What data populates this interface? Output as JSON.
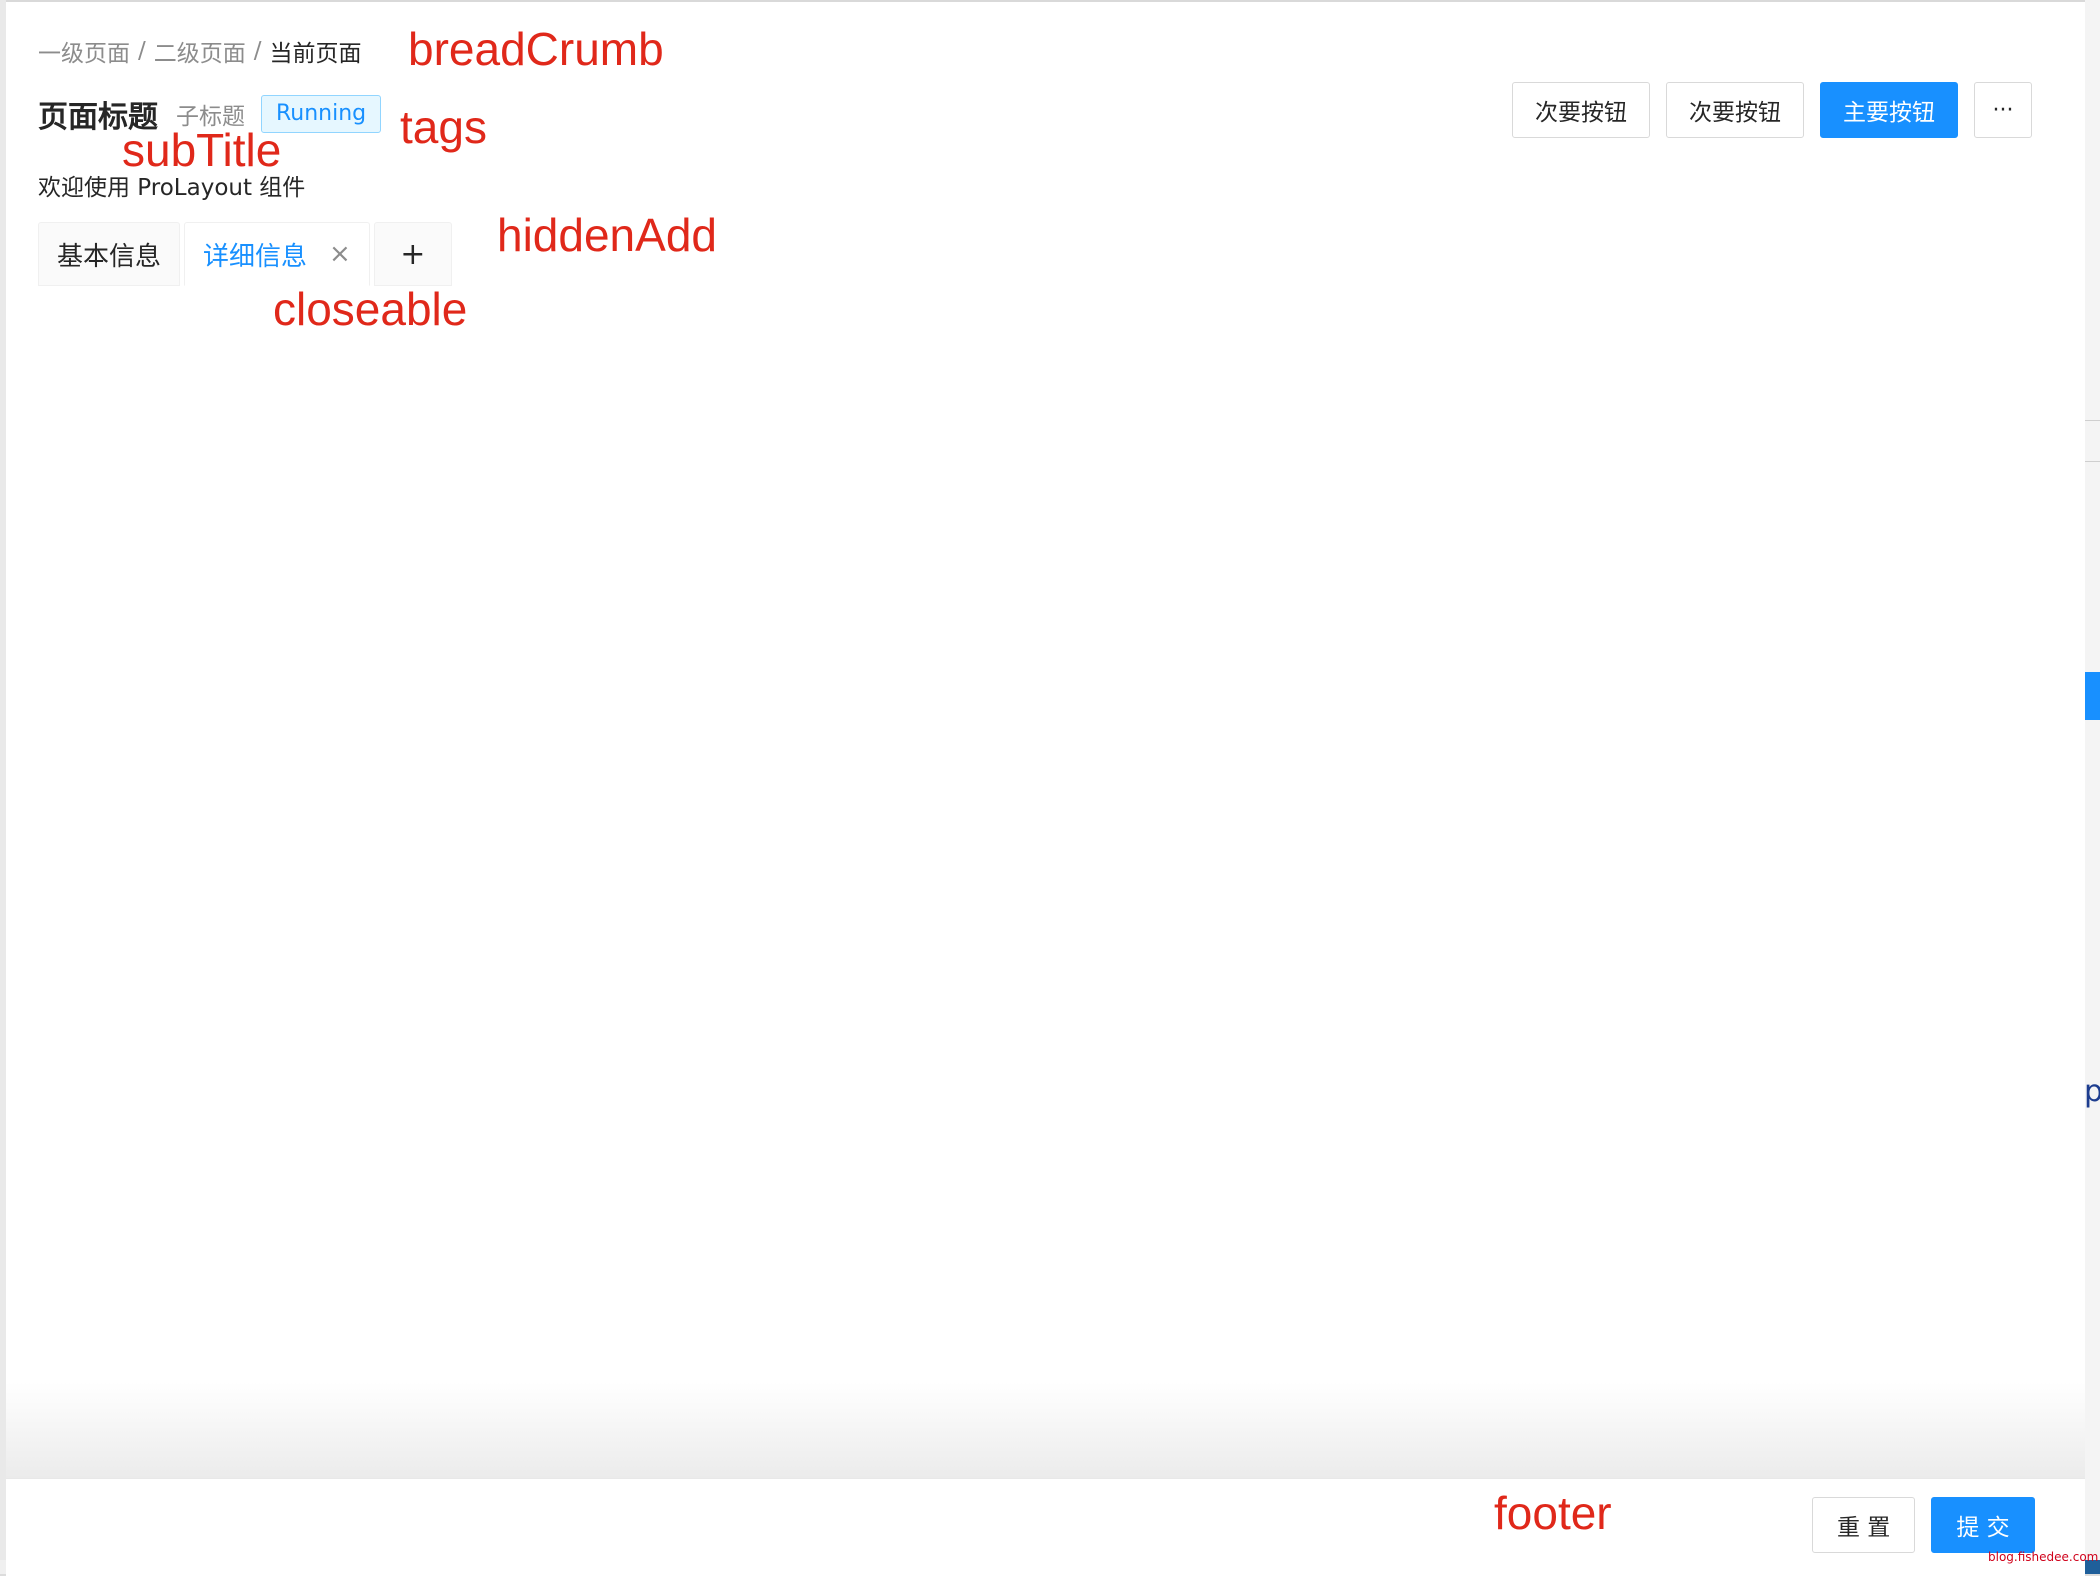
{
  "breadcrumb": [
    "一级页面",
    "二级页面",
    "当前页面"
  ],
  "breadcrumb_separator": "/",
  "header": {
    "title": "页面标题",
    "subtitle": "子标题",
    "tag": "Running",
    "content": "欢迎使用 ProLayout 组件"
  },
  "actions": {
    "secondary_1": "次要按钮",
    "secondary_2": "次要按钮",
    "primary": "主要按钮",
    "more": "···"
  },
  "tabs": [
    {
      "label": "基本信息",
      "active": false
    },
    {
      "label": "详细信息",
      "active": true,
      "closable": true
    }
  ],
  "tab_close_glyph": "×",
  "tab_add_glyph": "+",
  "footer": {
    "reset": "重 置",
    "submit": "提 交"
  },
  "annotations": {
    "breadcrumb": "breadCrumb",
    "tags": "tags",
    "subtitle": "subTitle",
    "hidden_add": "hiddenAdd",
    "closeable": "closeable",
    "footer": "footer"
  },
  "watermark": "blog.fishedee.com",
  "colors": {
    "primary": "#1890ff",
    "annotation": "#e0281a",
    "tag_bg": "#e6f7ff",
    "tag_border": "#91d5ff"
  }
}
